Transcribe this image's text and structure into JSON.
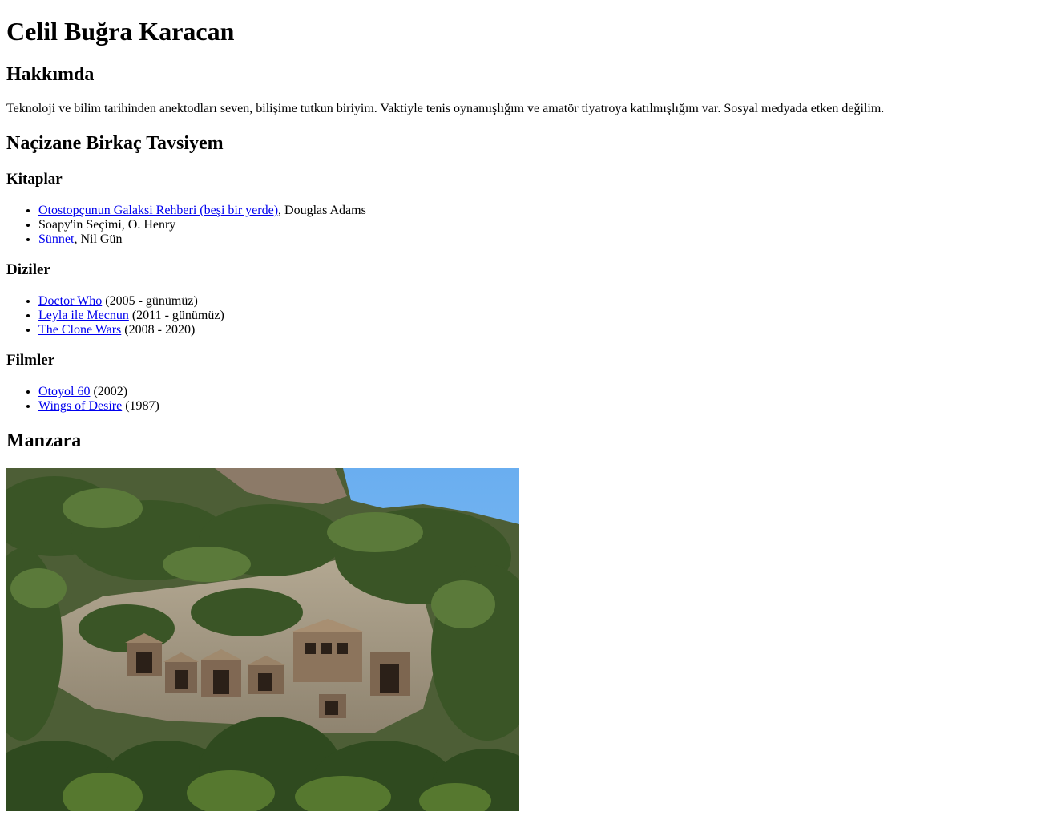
{
  "header": {
    "name": "Celil Buğra Karacan"
  },
  "about": {
    "heading": "Hakkımda",
    "text": "Teknoloji ve bilim tarihinden anektodları seven, bilişime tutkun biriyim. Vaktiyle tenis oynamışlığım ve amatör tiyatroya katılmışlığım var. Sosyal medyada etken değilim."
  },
  "recommendations": {
    "heading": "Naçizane Birkaç Tavsiyem",
    "books": {
      "heading": "Kitaplar",
      "items": [
        {
          "link": "Otostopçunun Galaksi Rehberi (beşi bir yerde)",
          "rest": ", Douglas Adams"
        },
        {
          "link": "",
          "rest": "Soapy'in Seçimi, O. Henry"
        },
        {
          "link": "Sünnet",
          "rest": ", Nil Gün"
        }
      ]
    },
    "series": {
      "heading": "Diziler",
      "items": [
        {
          "link": "Doctor Who",
          "rest": " (2005 - günümüz)"
        },
        {
          "link": "Leyla ile Mecnun",
          "rest": " (2011 - günümüz)"
        },
        {
          "link": "The Clone Wars",
          "rest": " (2008 - 2020)"
        }
      ]
    },
    "films": {
      "heading": "Filmler",
      "items": [
        {
          "link": "Otoyol 60",
          "rest": " (2002)"
        },
        {
          "link": "Wings of Desire",
          "rest": " (1987)"
        }
      ]
    }
  },
  "view": {
    "heading": "Manzara",
    "colors": {
      "sky": "#6fb4f0",
      "rock": "#a89c88",
      "foliage": "#3f5a2a",
      "tomb": "#8a7056"
    }
  }
}
